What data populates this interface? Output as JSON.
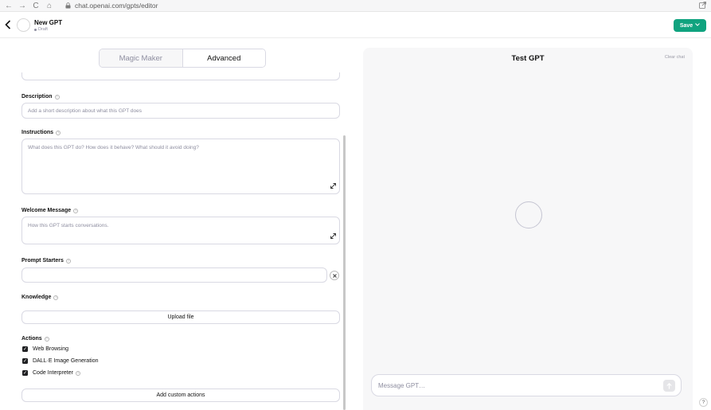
{
  "browser": {
    "back": "←",
    "forward": "→",
    "reload": "C",
    "home": "⌂",
    "url": "chat.openai.com/gpts/editor"
  },
  "header": {
    "title": "New GPT",
    "status": "Draft",
    "save_label": "Save"
  },
  "tabs": [
    {
      "label": "Magic Maker"
    },
    {
      "label": "Advanced"
    }
  ],
  "form": {
    "description": {
      "label": "Description",
      "placeholder": "Add a short description about what this GPT does"
    },
    "instructions": {
      "label": "Instructions",
      "placeholder": "What does this GPT do? How does it behave? What should it avoid doing?"
    },
    "welcome": {
      "label": "Welcome Message",
      "placeholder": "How this GPT starts conversations."
    },
    "prompt_starters": {
      "label": "Prompt Starters",
      "value": ""
    },
    "knowledge": {
      "label": "Knowledge",
      "upload_label": "Upload file"
    },
    "actions": {
      "label": "Actions",
      "items": [
        {
          "label": "Web Browsing",
          "checked": true
        },
        {
          "label": "DALL·E Image Generation",
          "checked": true
        },
        {
          "label": "Code Interpreter",
          "checked": true
        }
      ],
      "add_custom_label": "Add custom actions"
    }
  },
  "preview": {
    "title": "Test GPT",
    "clear_label": "Clear chat",
    "message_placeholder": "Message GPT…"
  },
  "help_label": "?",
  "colors": {
    "accent": "#10a37f",
    "preview_bg": "#f7f7f8"
  }
}
